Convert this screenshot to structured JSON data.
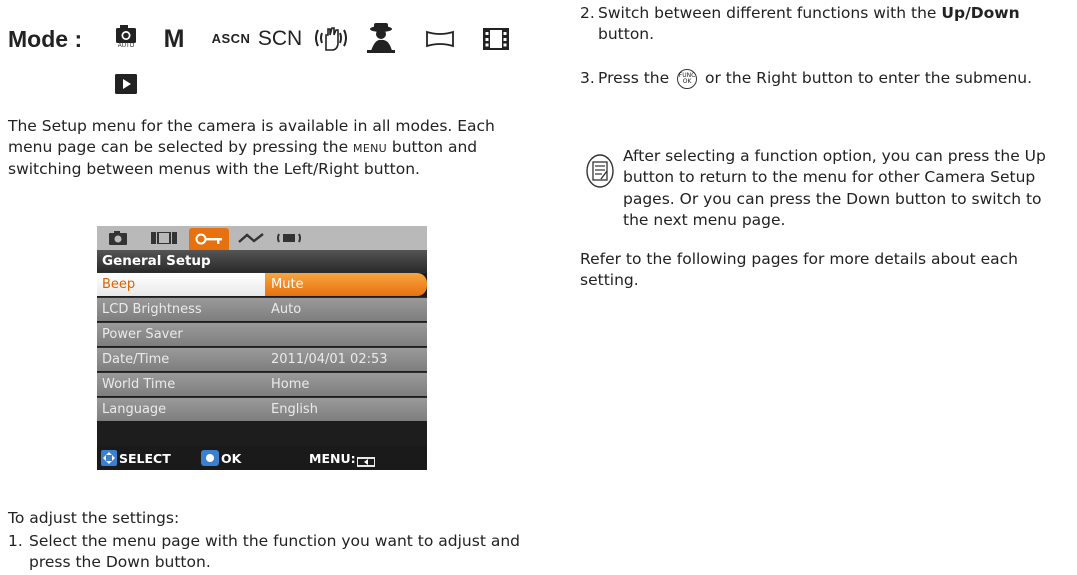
{
  "mode_row": {
    "label": "Mode :",
    "icons": [
      "camera-auto-icon",
      "manual-mode-m-icon",
      "auto-scene-icon",
      "scene-scn-icon",
      "hand-stabilization-icon",
      "portrait-icon",
      "panorama-icon",
      "movie-icon",
      "playback-icon"
    ],
    "auto_caption": "AUTO",
    "m_text": "M",
    "asc_text": "ASCN",
    "scn_text": "SCN"
  },
  "intro": {
    "text_before": "The Setup menu for the camera is available in all modes. Each menu page can be selected by pressing the ",
    "menu_word": "MENU",
    "text_after": " button and switching between menus with the Left/Right button."
  },
  "camera_screen": {
    "tabs": [
      "camera-tab-icon",
      "image-tab-icon",
      "setup-key-tab-icon",
      "graph-tab-icon",
      "connection-tab-icon"
    ],
    "active_tab_index": 2,
    "title": "General Setup",
    "rows": [
      {
        "key": "Beep",
        "value": "Mute"
      },
      {
        "key": "LCD Brightness",
        "value": "Auto"
      },
      {
        "key": "Power Saver",
        "value": ""
      },
      {
        "key": "Date/Time",
        "value": "2011/04/01 02:53"
      },
      {
        "key": "World Time",
        "value": "Home"
      },
      {
        "key": "Language",
        "value": "English"
      }
    ],
    "bottom": {
      "select": "SELECT",
      "ok": "OK",
      "menu": "MENU:"
    }
  },
  "adjust": {
    "heading": "To adjust the settings:",
    "step1_num": "1.",
    "step1": "Select the menu page with the function you want to adjust and press the Down button."
  },
  "right": {
    "step2_num": "2.",
    "step2_before": "Switch between different functions with the ",
    "step2_bold": "Up/Down",
    "step2_after": " button.",
    "step3_num": "3.",
    "step3_before": "Press the ",
    "func_top": "FUNC",
    "func_bottom": "OK",
    "step3_after": " or the Right button to enter the submenu.",
    "note": "After selecting a function option, you can press the Up button to return to the menu for other Camera Setup pages. Or you can press the Down button to switch to the next menu page.",
    "refer": "Refer to the following pages for more details about each setting."
  }
}
